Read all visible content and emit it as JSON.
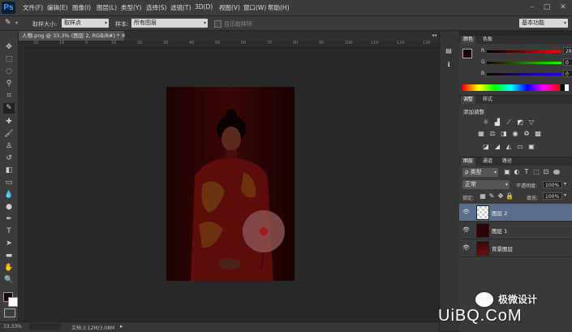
{
  "app": {
    "logo": "Ps"
  },
  "menu": [
    "文件(F)",
    "编辑(E)",
    "图像(I)",
    "图层(L)",
    "类型(Y)",
    "选择(S)",
    "滤镜(T)",
    "3D(D)",
    "视图(V)",
    "窗口(W)",
    "帮助(H)"
  ],
  "window_controls": {
    "minimize": "–",
    "restore": "□",
    "close": "✕"
  },
  "options": {
    "sample_size_label": "取样大小:",
    "sample_size_value": "取样点",
    "sample_label": "样本:",
    "sample_value": "所有图层",
    "show_ring_label": "显示取样环",
    "workspace": "基本功能"
  },
  "document": {
    "tab_title": "人物.png @ 33.3% (图层 2, RGB/8#) *",
    "zoom": "33.33%",
    "doc_size": "文档:3.12M/3.08M"
  },
  "ruler_top_ticks": [
    "20",
    "10",
    "0",
    "10",
    "20",
    "30",
    "40",
    "50",
    "60",
    "70",
    "80",
    "90",
    "100",
    "110",
    "120",
    "130"
  ],
  "color_panel": {
    "tabs": [
      "颜色",
      "色板"
    ],
    "channels": [
      {
        "label": "R",
        "value": "28"
      },
      {
        "label": "G",
        "value": "0"
      },
      {
        "label": "B",
        "value": "0"
      }
    ],
    "foreground": "#1c0000",
    "background": "#ffffff"
  },
  "adjustments_panel": {
    "tabs": [
      "调整",
      "样式"
    ],
    "add_label": "添加调整",
    "row1": [
      "brightness-icon",
      "levels-icon",
      "curves-icon",
      "exposure-icon",
      "vibrance-icon"
    ],
    "row2": [
      "hue-icon",
      "color-balance-icon",
      "bw-icon",
      "photo-filter-icon",
      "channel-mixer-icon",
      "color-lookup-icon"
    ],
    "row3": [
      "invert-icon",
      "posterize-icon",
      "threshold-icon",
      "gradient-map-icon",
      "selective-color-icon"
    ]
  },
  "layers_panel": {
    "tabs": [
      "图层",
      "通道",
      "路径"
    ],
    "filter_kind": "类型",
    "blend_mode": "正常",
    "opacity_label": "不透明度:",
    "opacity_value": "100%",
    "lock_label": "锁定:",
    "fill_label": "填充:",
    "fill_value": "100%",
    "layers": [
      {
        "name": "图层 2",
        "active": true
      },
      {
        "name": "图层 1",
        "active": false
      },
      {
        "name": "背景图层",
        "active": false
      }
    ]
  },
  "watermark": {
    "text": "极微设计",
    "site": "UiBQ.CoM"
  }
}
